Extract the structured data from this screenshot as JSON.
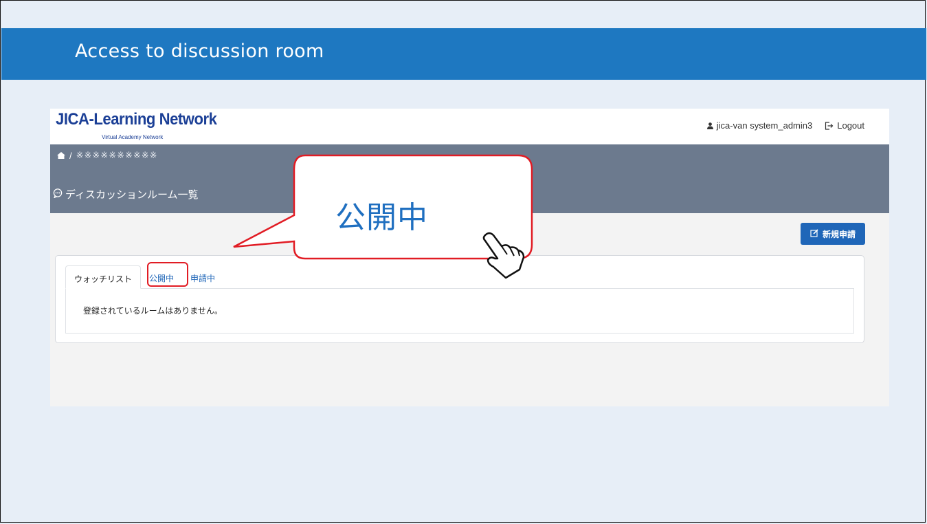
{
  "slide": {
    "title": "Access to discussion room"
  },
  "site": {
    "logo_title": "JICA-Learning Network",
    "logo_subtitle": "Virtual Academy Network",
    "user_name": "jica-van system_admin3",
    "logout_label": "Logout"
  },
  "nav": {
    "breadcrumb_separator": "/",
    "breadcrumb_current": "※※※※※※※※※※",
    "page_heading": "ディスカッションルーム一覧"
  },
  "actions": {
    "new_request_label": "新規申請"
  },
  "tabs": [
    {
      "label": "ウォッチリスト"
    },
    {
      "label": "公開中"
    },
    {
      "label": "申請中"
    }
  ],
  "panel": {
    "empty_message": "登録されているルームはありません。"
  },
  "callout": {
    "text": "公開中"
  },
  "icons": {
    "home": "home-icon",
    "user": "user-icon",
    "logout": "logout-icon",
    "chat": "chat-bubble-icon",
    "edit": "edit-icon",
    "pointer": "pointing-hand-icon"
  },
  "colors": {
    "slide_header": "#1e78c1",
    "nav_bar": "#6c7a8e",
    "primary": "#1f66b8",
    "highlight": "#e11c24"
  }
}
